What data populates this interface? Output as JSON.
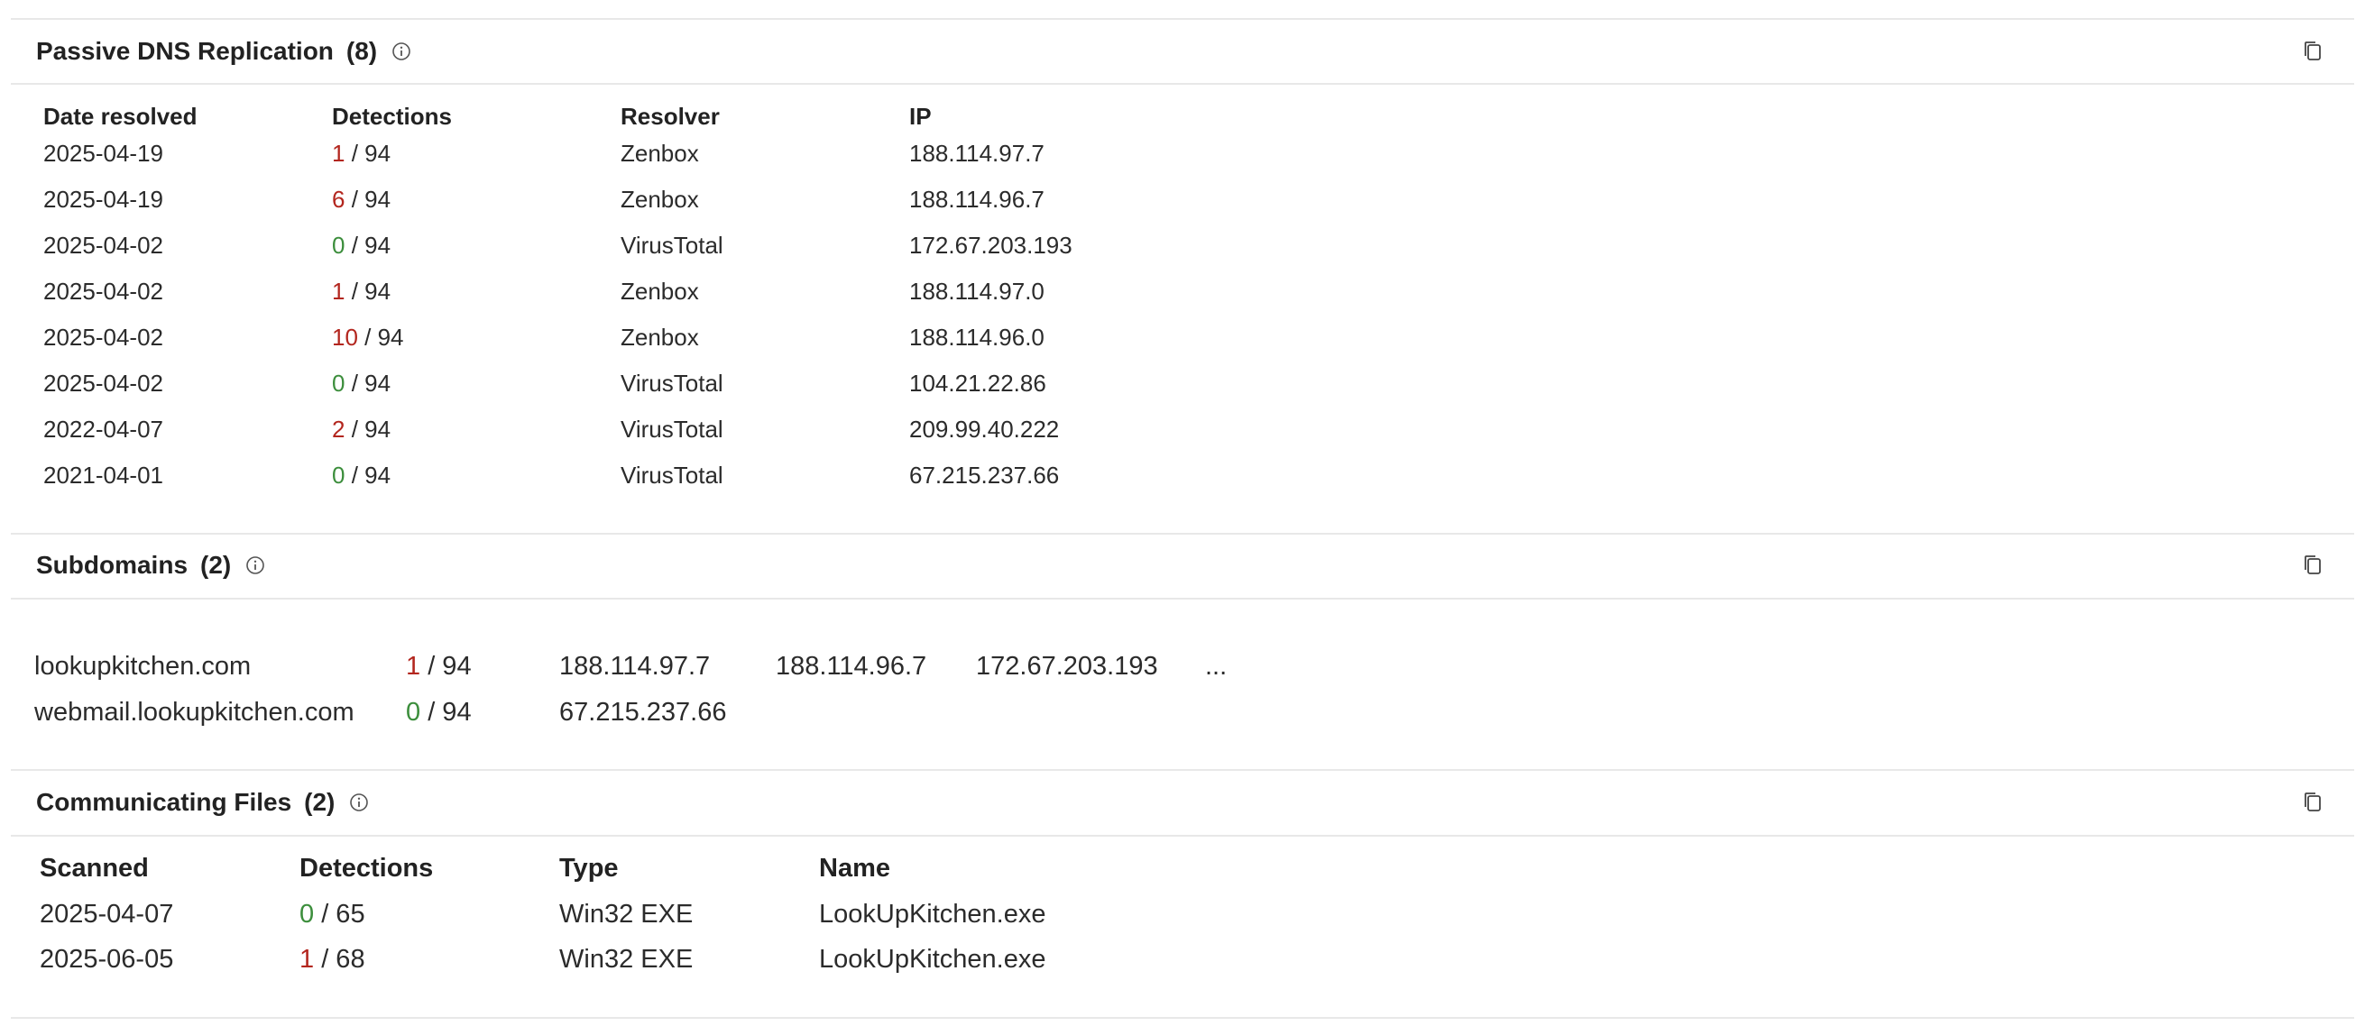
{
  "colors": {
    "detection_positive": "#b3261e",
    "detection_zero": "#3c8e3c",
    "divider": "#e8e8e8"
  },
  "dns": {
    "title": "Passive DNS Replication",
    "count": "(8)",
    "headers": [
      "Date resolved",
      "Detections",
      "Resolver",
      "IP"
    ],
    "rows": [
      {
        "date": "2025-04-19",
        "det": "1",
        "total": "/ 94",
        "resolver": "Zenbox",
        "ip": "188.114.97.7"
      },
      {
        "date": "2025-04-19",
        "det": "6",
        "total": "/ 94",
        "resolver": "Zenbox",
        "ip": "188.114.96.7"
      },
      {
        "date": "2025-04-02",
        "det": "0",
        "total": "/ 94",
        "resolver": "VirusTotal",
        "ip": "172.67.203.193"
      },
      {
        "date": "2025-04-02",
        "det": "1",
        "total": "/ 94",
        "resolver": "Zenbox",
        "ip": "188.114.97.0"
      },
      {
        "date": "2025-04-02",
        "det": "10",
        "total": "/ 94",
        "resolver": "Zenbox",
        "ip": "188.114.96.0"
      },
      {
        "date": "2025-04-02",
        "det": "0",
        "total": "/ 94",
        "resolver": "VirusTotal",
        "ip": "104.21.22.86"
      },
      {
        "date": "2022-04-07",
        "det": "2",
        "total": "/ 94",
        "resolver": "VirusTotal",
        "ip": "209.99.40.222"
      },
      {
        "date": "2021-04-01",
        "det": "0",
        "total": "/ 94",
        "resolver": "VirusTotal",
        "ip": "67.215.237.66"
      }
    ]
  },
  "subdomains": {
    "title": "Subdomains",
    "count": "(2)",
    "rows": [
      {
        "domain": "lookupkitchen.com",
        "det": "1",
        "total": "/ 94",
        "ips": [
          "188.114.97.7",
          "188.114.96.7",
          "172.67.203.193"
        ],
        "more": "..."
      },
      {
        "domain": "webmail.lookupkitchen.com",
        "det": "0",
        "total": "/ 94",
        "ips": [
          "67.215.237.66"
        ],
        "more": ""
      }
    ]
  },
  "files": {
    "title": "Communicating Files",
    "count": "(2)",
    "headers": [
      "Scanned",
      "Detections",
      "Type",
      "Name"
    ],
    "rows": [
      {
        "scanned": "2025-04-07",
        "det": "0",
        "total": "/ 65",
        "type": "Win32 EXE",
        "name": "LookUpKitchen.exe"
      },
      {
        "scanned": "2025-06-05",
        "det": "1",
        "total": "/ 68",
        "type": "Win32 EXE",
        "name": "LookUpKitchen.exe"
      }
    ]
  },
  "icons": {
    "info": "info-icon",
    "copy": "copy-icon"
  }
}
